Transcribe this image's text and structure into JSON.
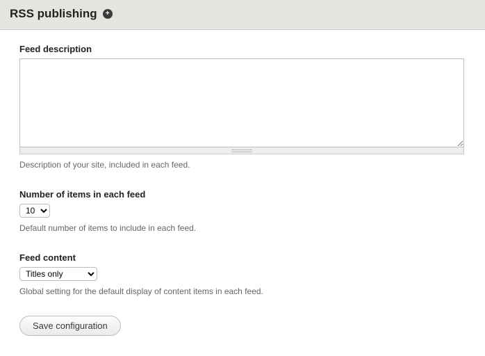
{
  "header": {
    "title": "RSS publishing"
  },
  "fields": {
    "feed_description": {
      "label": "Feed description",
      "value": "",
      "help": "Description of your site, included in each feed."
    },
    "items_per_feed": {
      "label": "Number of items in each feed",
      "selected": "10",
      "help": "Default number of items to include in each feed."
    },
    "feed_content": {
      "label": "Feed content",
      "selected": "Titles only",
      "help": "Global setting for the default display of content items in each feed."
    }
  },
  "actions": {
    "save_label": "Save configuration"
  }
}
